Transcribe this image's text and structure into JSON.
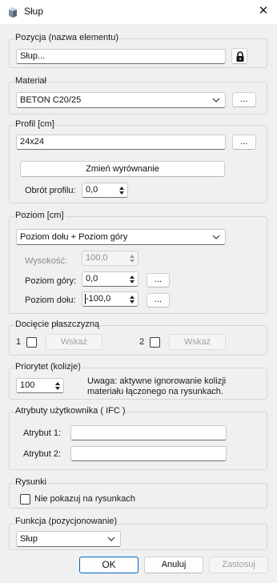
{
  "window": {
    "title": "Słup",
    "close_glyph": "✕"
  },
  "pozycja": {
    "label": "Pozycja (nazwa elementu)",
    "value": "Słup...",
    "lock_icon": "lock-icon"
  },
  "material": {
    "label": "Materiał",
    "value": "BETON C20/25",
    "more": "..."
  },
  "profil": {
    "label": "Profil [cm]",
    "value": "24x24",
    "more": "...",
    "change_button": "Zmień wyrównanie",
    "rotation_label": "Obrót profilu:",
    "rotation_value": "0,0"
  },
  "poziom": {
    "label": "Poziom [cm]",
    "mode": "Poziom dołu + Poziom góry",
    "height_label": "Wysokość:",
    "height_value": "100,0",
    "top_label": "Poziom góry:",
    "top_value": "0,0",
    "top_more": "...",
    "bottom_label": "Poziom dołu:",
    "bottom_value": "-100,0",
    "bottom_more": "..."
  },
  "dociecie": {
    "label": "Docięcie płaszczyzną",
    "opt1": "1",
    "opt2": "2",
    "show1": "Wskaż",
    "show2": "Wskaż"
  },
  "priorytet": {
    "label": "Priorytet (kolizje)",
    "value": "100",
    "note_line1": "Uwaga: aktywne ignorowanie kolizji",
    "note_line2": "materiału łączonego na rysunkach."
  },
  "atrybuty": {
    "label": "Atrybuty użytkownika ( IFC )",
    "attr1_label": "Atrybut 1:",
    "attr1_value": "",
    "attr2_label": "Atrybut 2:",
    "attr2_value": ""
  },
  "rysunki": {
    "label": "Rysunki",
    "hide_label": "Nie pokazuj na rysunkach"
  },
  "funkcja": {
    "label": "Funkcja (pozycjonowanie)",
    "value": "Słup"
  },
  "buttons": {
    "ok": "OK",
    "cancel": "Anuluj",
    "apply": "Zastosuj"
  },
  "colors": {
    "accent": "#0067c0",
    "background": "#f0f0f0"
  }
}
